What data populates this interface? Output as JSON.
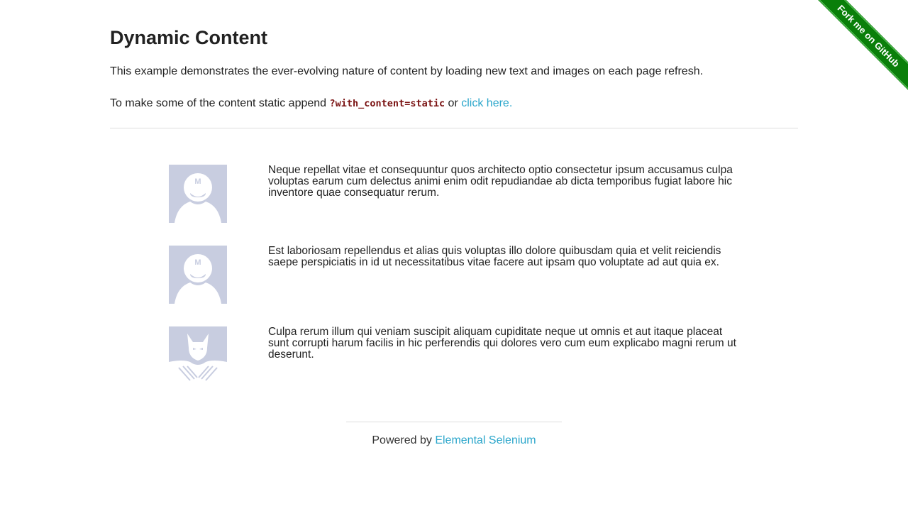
{
  "header": {
    "title": "Dynamic Content",
    "intro": "This example demonstrates the ever-evolving nature of content by loading new text and images on each page refresh.",
    "static_prefix": "To make some of the content static append",
    "static_param": "?with_content=static",
    "static_or": "or",
    "static_link": "click here."
  },
  "rows": [
    {
      "avatar": "mario-avatar-icon",
      "text": "Neque repellat vitae et consequuntur quos architecto optio consectetur ipsum accusamus culpa voluptas earum cum delectus animi enim odit repudiandae ab dicta temporibus fugiat labore hic inventore quae consequatur rerum."
    },
    {
      "avatar": "mario-avatar-icon",
      "text": "Est laboriosam repellendus et alias quis voluptas illo dolore quibusdam quia et velit reiciendis saepe perspiciatis in id ut necessitatibus vitae facere aut ipsam quo voluptate ad aut quia ex."
    },
    {
      "avatar": "wolverine-avatar-icon",
      "text": "Culpa rerum illum qui veniam suscipit aliquam cupiditate neque ut omnis et aut itaque placeat sunt corrupti harum facilis in hic perferendis qui dolores vero cum eum explicabo magni rerum ut deserunt."
    }
  ],
  "footer": {
    "prefix": "Powered by",
    "link": "Elemental Selenium"
  },
  "ribbon": {
    "label": "Fork me on GitHub"
  },
  "colors": {
    "link": "#2ba6cb",
    "code": "#7a1212",
    "ribbon": "#0a7f0a",
    "avatar_bg": "#c8cde0"
  }
}
